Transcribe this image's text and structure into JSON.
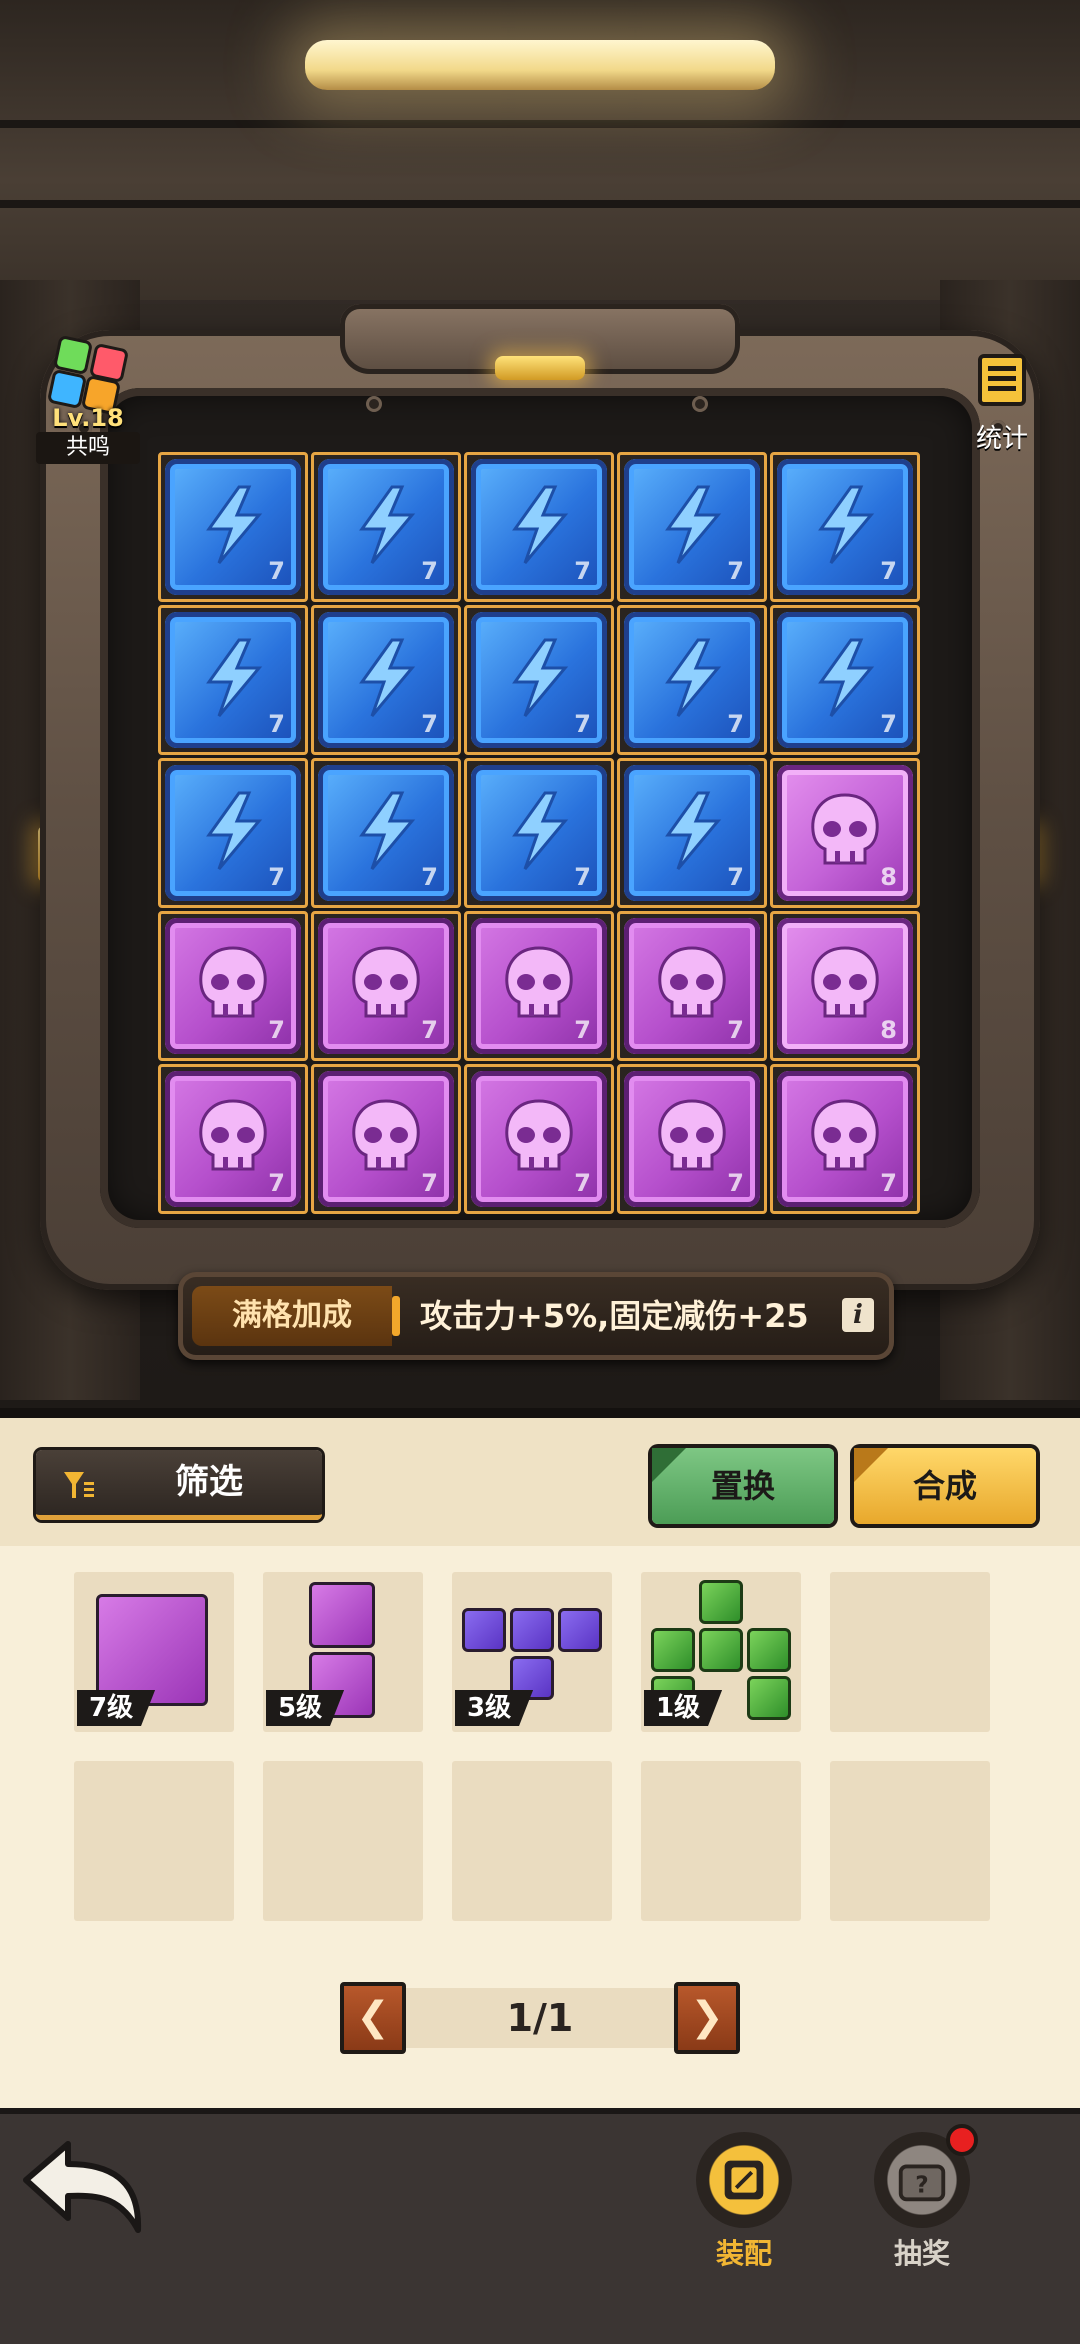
{
  "resonance": {
    "level": "Lv.18",
    "label": "共鸣"
  },
  "stats": {
    "label": "统计"
  },
  "board": {
    "cells": [
      {
        "type": "blue",
        "level": "7"
      },
      {
        "type": "blue",
        "level": "7"
      },
      {
        "type": "blue",
        "level": "7"
      },
      {
        "type": "blue",
        "level": "7"
      },
      {
        "type": "blue",
        "level": "7"
      },
      {
        "type": "blue",
        "level": "7"
      },
      {
        "type": "blue",
        "level": "7"
      },
      {
        "type": "blue",
        "level": "7"
      },
      {
        "type": "blue",
        "level": "7"
      },
      {
        "type": "blue",
        "level": "7"
      },
      {
        "type": "blue",
        "level": "7"
      },
      {
        "type": "blue",
        "level": "7"
      },
      {
        "type": "blue",
        "level": "7"
      },
      {
        "type": "blue",
        "level": "7"
      },
      {
        "type": "purple",
        "level": "8"
      },
      {
        "type": "purple",
        "level": "7"
      },
      {
        "type": "purple",
        "level": "7"
      },
      {
        "type": "purple",
        "level": "7"
      },
      {
        "type": "purple",
        "level": "7"
      },
      {
        "type": "purple",
        "level": "8"
      },
      {
        "type": "purple",
        "level": "7"
      },
      {
        "type": "purple",
        "level": "7"
      },
      {
        "type": "purple",
        "level": "7"
      },
      {
        "type": "purple",
        "level": "7"
      },
      {
        "type": "purple",
        "level": "7"
      }
    ]
  },
  "bonus": {
    "tag": "满格加成",
    "text": "攻击力+5%,固定减伤+25",
    "info": "i"
  },
  "panel": {
    "filter_label": "筛选",
    "swap_label": "置换",
    "merge_label": "合成",
    "slots": [
      {
        "level": "7级",
        "shape": "purple-single"
      },
      {
        "level": "5级",
        "shape": "purple-vertical"
      },
      {
        "level": "3级",
        "shape": "violet-t"
      },
      {
        "level": "1级",
        "shape": "green-cluster"
      },
      {
        "level": "",
        "shape": "empty"
      },
      {
        "level": "",
        "shape": "empty"
      },
      {
        "level": "",
        "shape": "empty"
      },
      {
        "level": "",
        "shape": "empty"
      },
      {
        "level": "",
        "shape": "empty"
      },
      {
        "level": "",
        "shape": "empty"
      }
    ],
    "pager": {
      "prev": "❮",
      "next": "❯",
      "text": "1/1"
    }
  },
  "nav": {
    "equip_label": "装配",
    "draw_label": "抽奖"
  },
  "colors": {
    "accent_gold": "#e7a644",
    "blue_tile": "#2a73dd",
    "purple_tile": "#b54fcc",
    "nav_label": "#f2b633"
  }
}
